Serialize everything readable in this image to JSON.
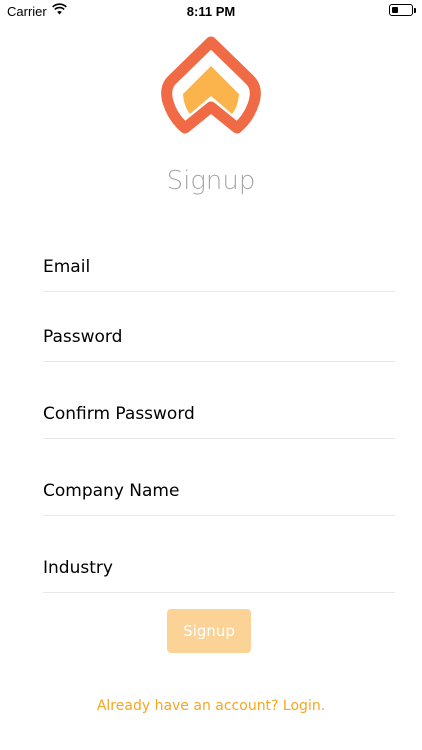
{
  "status_bar": {
    "carrier": "Carrier",
    "time": "8:11 PM",
    "battery_level": 0.35
  },
  "brand": {
    "logo_icon": "double-chevron-up-logo",
    "outer_color": "#ef6a45",
    "inner_color": "#fbb44b"
  },
  "form": {
    "title": "Signup",
    "fields": [
      {
        "placeholder": "Email",
        "value": ""
      },
      {
        "placeholder": "Password",
        "value": ""
      },
      {
        "placeholder": "Confirm Password",
        "value": ""
      },
      {
        "placeholder": "Company Name",
        "value": ""
      },
      {
        "placeholder": "Industry",
        "value": ""
      }
    ],
    "submit_label": "Signup",
    "submit_color": "#fcd396"
  },
  "footer": {
    "login_link": "Already have an account? Login.",
    "link_color": "#f5a623"
  }
}
